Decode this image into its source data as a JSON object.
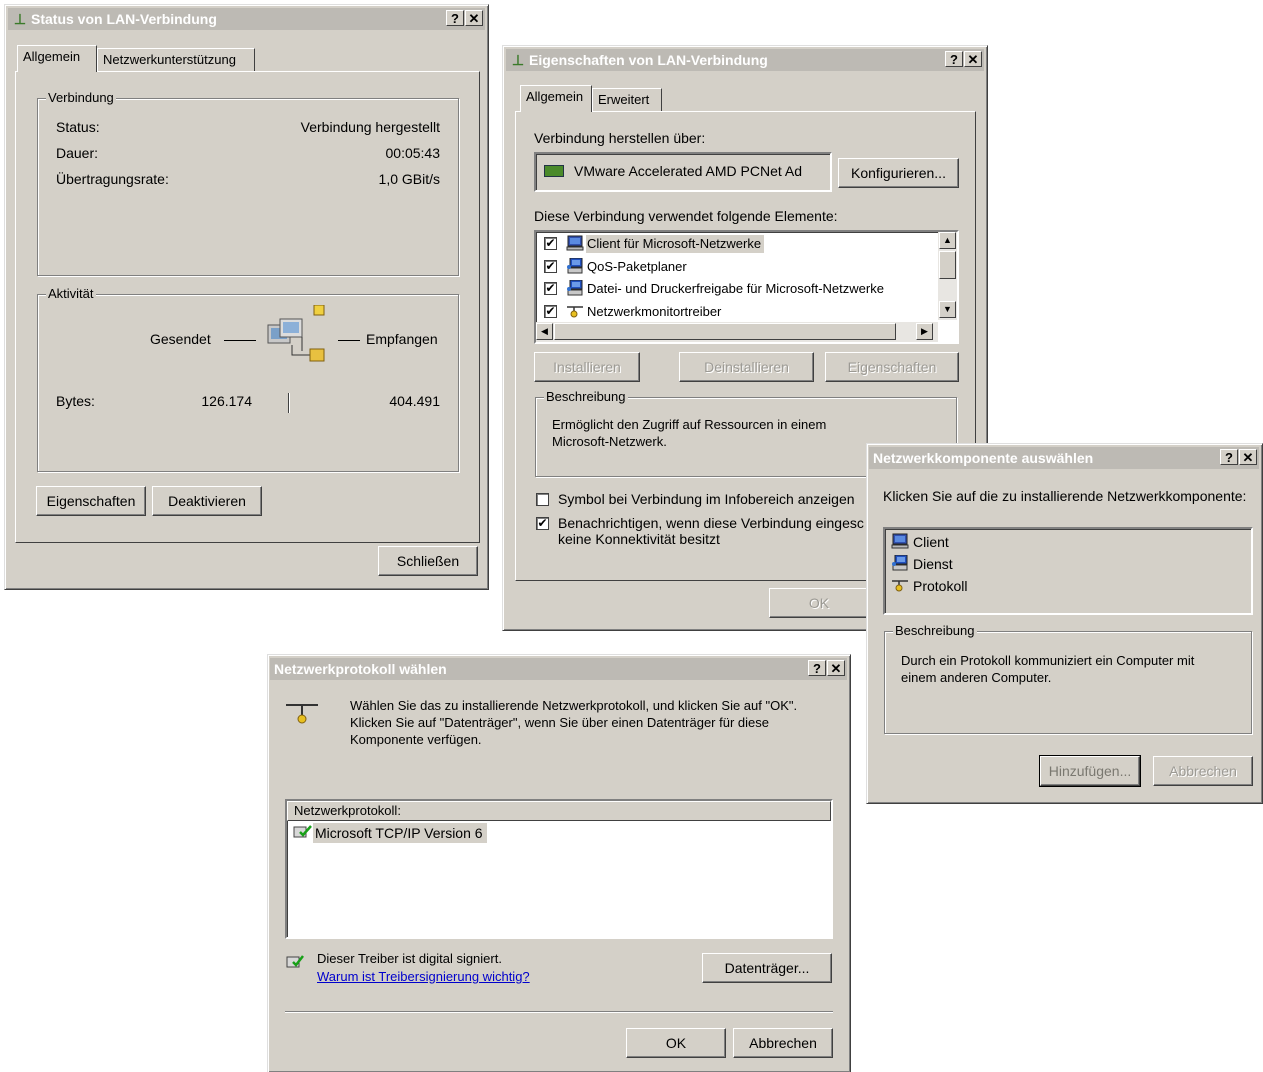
{
  "status_dialog": {
    "title": "Status von LAN-Verbindung",
    "help_btn": "?",
    "close_btn": "✕",
    "tabs": [
      "Allgemein",
      "Netzwerkunterstützung"
    ],
    "connection_legend": "Verbindung",
    "rows": [
      {
        "label": "Status:",
        "value": "Verbindung hergestellt"
      },
      {
        "label": "Dauer:",
        "value": "00:05:43"
      },
      {
        "label": "Übertragungsrate:",
        "value": "1,0 GBit/s"
      }
    ],
    "activity_legend": "Aktivität",
    "sent_label": "Gesendet",
    "received_label": "Empfangen",
    "bytes_label": "Bytes:",
    "bytes_sent": "126.174",
    "bytes_received": "404.491",
    "properties_btn": "Eigenschaften",
    "disable_btn": "Deaktivieren",
    "close_btn_label": "Schließen"
  },
  "properties_dialog": {
    "title": "Eigenschaften von LAN-Verbindung",
    "help_btn": "?",
    "close_btn": "✕",
    "tabs": [
      "Allgemein",
      "Erweitert"
    ],
    "connect_using_label": "Verbindung herstellen über:",
    "adapter_name": "VMware Accelerated AMD PCNet Ad",
    "configure_btn": "Konfigurieren...",
    "elements_label": "Diese Verbindung verwendet folgende Elemente:",
    "items": [
      {
        "label": "Client für Microsoft-Netzwerke",
        "checked": true,
        "icon": "client-icon",
        "selected": true
      },
      {
        "label": "QoS-Paketplaner",
        "checked": true,
        "icon": "service-icon"
      },
      {
        "label": "Datei- und Druckerfreigabe für Microsoft-Netzwerke",
        "checked": true,
        "icon": "service-icon"
      },
      {
        "label": "Netzwerkmonitortreiber",
        "checked": true,
        "icon": "protocol-icon"
      }
    ],
    "install_btn": "Installieren",
    "uninstall_btn": "Deinstallieren",
    "properties_btn": "Eigenschaften",
    "description_legend": "Beschreibung",
    "description_text": "Ermöglicht den Zugriff auf Ressourcen in einem Microsoft-Netzwerk.",
    "show_icon_label": "Symbol bei Verbindung im Infobereich anzeigen",
    "show_icon_checked": false,
    "notify_label": "Benachrichtigen, wenn diese Verbindung eingesc",
    "notify_label_2": "keine Konnektivität besitzt",
    "notify_checked": true,
    "ok_btn": "OK"
  },
  "component_dialog": {
    "title": "Netzwerkkomponente auswählen",
    "help_btn": "?",
    "close_btn": "✕",
    "instruction": "Klicken Sie auf die zu installierende Netzwerkkomponente:",
    "items": [
      {
        "label": "Client",
        "icon": "client-icon"
      },
      {
        "label": "Dienst",
        "icon": "service-icon"
      },
      {
        "label": "Protokoll",
        "icon": "protocol-icon"
      }
    ],
    "description_legend": "Beschreibung",
    "description_text": "Durch ein Protokoll kommuniziert ein Computer mit einem anderen Computer.",
    "add_btn": "Hinzufügen...",
    "cancel_btn": "Abbrechen"
  },
  "protocol_dialog": {
    "title": "Netzwerkprotokoll wählen",
    "help_btn": "?",
    "close_btn": "✕",
    "instruction": "Wählen Sie das zu installierende Netzwerkprotokoll, und klicken Sie auf \"OK\". Klicken Sie auf \"Datenträger\", wenn Sie über einen Datenträger für diese Komponente verfügen.",
    "list_header": "Netzwerkprotokoll:",
    "items": [
      {
        "label": "Microsoft TCP/IP Version 6",
        "icon": "signed-driver-icon"
      }
    ],
    "signed_text": "Dieser Treiber ist digital signiert.",
    "signing_link": "Warum ist Treibersignierung wichtig?",
    "disk_btn": "Datenträger...",
    "ok_btn": "OK",
    "cancel_btn": "Abbrechen"
  },
  "colors": {
    "dialog_bg": "#d4d0c8",
    "inactive_title": "#bdbab4",
    "selection": "#d4d0c8",
    "link": "#0000cc"
  }
}
